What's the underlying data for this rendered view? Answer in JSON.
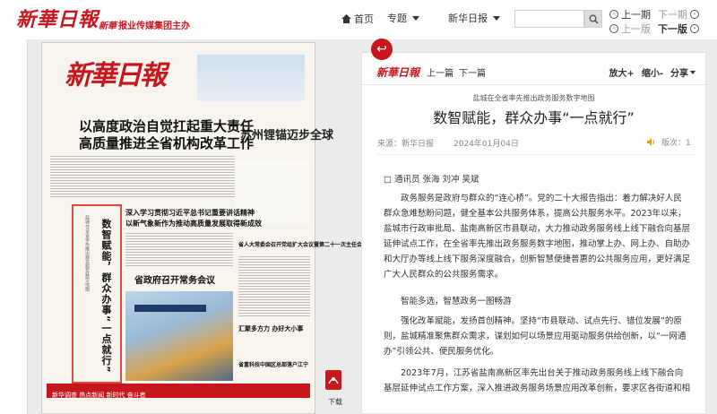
{
  "header": {
    "logo": "新華日報",
    "sublogo_mark": "新華",
    "sublogo": "报业传媒集团主办",
    "home": "首页",
    "dropdown_1": "专题",
    "dropdown_2": "新华日报",
    "search_placeholder": "",
    "prev_issue": "上一期",
    "next_issue": "下一期",
    "prev_page": "上一版",
    "next_page": "下一版"
  },
  "newspaper": {
    "masthead": "新華日報",
    "headline_1": "以高度政治自觉扛起重大责任",
    "headline_2": "高质量推进全省机构改革工作",
    "headline_3": "深入学习贯彻习近平总书记重要讲话精神",
    "headline_4": "以新气象新作为推动高质量发展取得新成效",
    "headline_5": "省政府召开常务会议",
    "headline_6": "苏州锂锚迈步全球",
    "headline_7": "省人大常委会召开党组扩大会议暨第二十一次主任会议",
    "headline_8": "汇聚多方力 办好大小事",
    "headline_9": "省重科技中国区总部落户江宁",
    "vertical_title": "数智赋能，群众办事“一点就行”",
    "vertical_sub": "盐城在全省率先推出政务服务数字地图",
    "bottom_strip": "新华调查 热点新闻 新时代 奋斗者"
  },
  "download": {
    "label": "下载"
  },
  "article_toolbar": {
    "logo": "新華日報",
    "prev": "上一篇",
    "next": "下一篇",
    "zoom_in": "放大+",
    "zoom_out": "缩小-",
    "share": "分享"
  },
  "article": {
    "kicker": "盐城在全省率先推出政务服务数字地图",
    "title": "数智赋能，群众办事“一点就行”",
    "source": "来源：新华日报",
    "date": "2024年01月04日",
    "edition": "版次：1",
    "paragraphs": [
      "□ 通讯员 张海 刘冲 吴斌",
      "政务服务是政府与群众的“连心桥”。党的二十大报告指出：着力解决好人民群众急难愁盼问题，健全基本公共服务体系，提高公共服务水平。2023年以来，盐城市行政审批局、盐南高新区市县联动，大力推动政务服务线上线下融合向基层延伸试点工作，在全省率先推出政务服务数字地图，推动掌上办、网上办、自助办和大厅办等线上线下服务深度融合，创新智慧便捷普惠的公共服务应用，更好满足广大人民群众的公共服务需求。",
      "智能多选，智慧政务一图畅游",
      "强化改革赋能，发扬首创精神。坚持“市县联动、试点先行、错位发展”的原则，盐城精准聚焦群众需求，谋划如何以场景应用驱动服务供给创新，以“一网通办”引领公共、便民服务优化。",
      "2023年7月，江苏省盐南高新区率先出台关于推动政务服务线上线下融合向基层延伸试点工作方案，深入推进政务服务场景应用改革创新，要求区各街道和相"
    ]
  }
}
